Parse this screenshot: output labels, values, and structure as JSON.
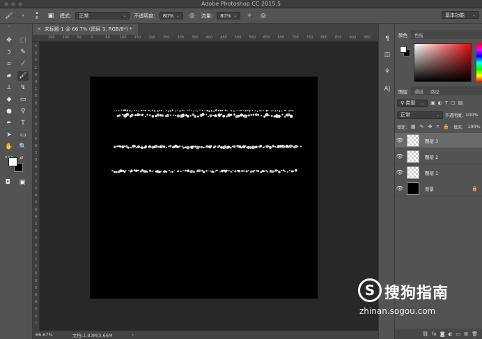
{
  "window": {
    "title": "Adobe Photoshop CC 2015.5"
  },
  "options_bar": {
    "mode_label": "模式:",
    "mode_value": "正常",
    "opacity_label": "不透明度:",
    "opacity_value": "80%",
    "flow_label": "流量:",
    "flow_value": "80%",
    "brush_size": "8",
    "workspace": "基本功能"
  },
  "document": {
    "tab_title": "未标题-1 @ 66.7% (图层 3, RGB/8*) *",
    "zoom": "66.67%",
    "doc_info": "文档:1.83M/3.66M"
  },
  "rulers": {
    "horizontal": [
      "150",
      "100",
      "50",
      "0",
      "50",
      "100",
      "150",
      "200",
      "250",
      "300",
      "350",
      "400",
      "450",
      "500",
      "550",
      "600",
      "650",
      "700",
      "750",
      "800",
      "850",
      "900",
      "950"
    ],
    "vertical": [
      "5",
      "0",
      "5",
      "1",
      "0",
      "0",
      "1",
      "5",
      "0",
      "2",
      "0",
      "0",
      "2",
      "5",
      "0",
      "3",
      "0",
      "0",
      "3",
      "5",
      "0",
      "4",
      "0",
      "0",
      "4",
      "5",
      "0",
      "5",
      "0",
      "0",
      "5",
      "5",
      "0",
      "6",
      "0",
      "0",
      "6",
      "5",
      "0",
      "7"
    ]
  },
  "color_panel": {
    "tabs": [
      "颜色",
      "色板"
    ],
    "foreground": "#ffffff",
    "background": "#000000"
  },
  "layers_panel": {
    "tabs": [
      "图层",
      "通道",
      "路径"
    ],
    "filter_label": "类型",
    "blend_mode": "正常",
    "opacity_label": "不透明度:",
    "opacity_value": "100%",
    "lock_label": "锁定:",
    "fill_label": "填充:",
    "fill_value": "100%",
    "layers": [
      {
        "name": "图层 3",
        "selected": true,
        "thumb": "transparent"
      },
      {
        "name": "图层 2",
        "selected": false,
        "thumb": "transparent"
      },
      {
        "name": "图层 1",
        "selected": false,
        "thumb": "transparent"
      },
      {
        "name": "背景",
        "selected": false,
        "thumb": "black",
        "locked": true
      }
    ]
  },
  "watermark": {
    "name": "搜狗指南",
    "url": "zhinan.sogou.com"
  }
}
